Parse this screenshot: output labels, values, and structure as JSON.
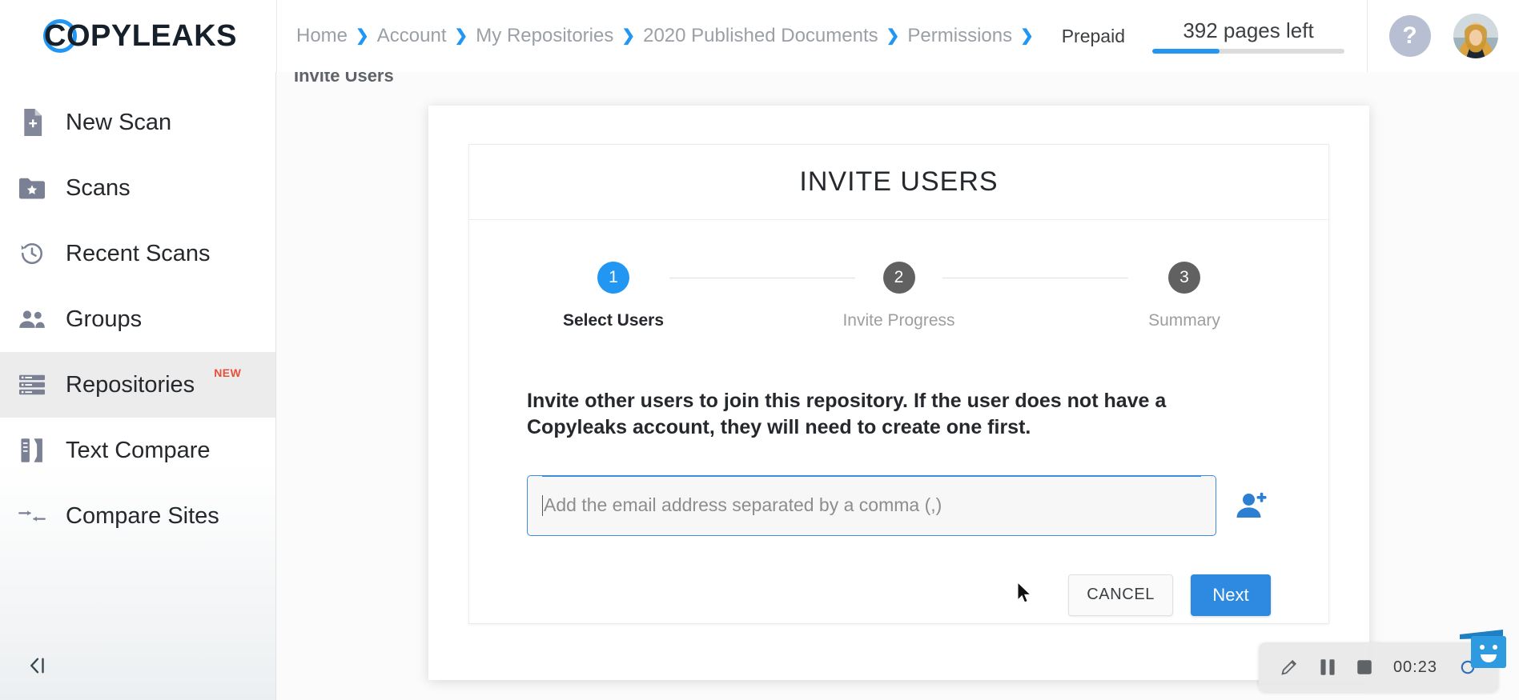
{
  "brand": {
    "name": "COPYLEAKS",
    "ring_color": "#2196f3",
    "accent_color": "#2196f3"
  },
  "header": {
    "breadcrumb": [
      "Home",
      "Account",
      "My Repositories",
      "2020 Published Documents",
      "Permissions"
    ],
    "breadcrumb_separator": "❯",
    "plan_label": "Prepaid",
    "quota_label": "392 pages left",
    "quota_percent": 35,
    "help_icon_glyph": "?",
    "help_icon_name": "question-mark-icon"
  },
  "sidebar": {
    "items": [
      {
        "label": "New Scan",
        "icon": "document-add-icon",
        "active": false,
        "badge": ""
      },
      {
        "label": "Scans",
        "icon": "folder-star-icon",
        "active": false,
        "badge": ""
      },
      {
        "label": "Recent Scans",
        "icon": "history-clock-icon",
        "active": false,
        "badge": ""
      },
      {
        "label": "Groups",
        "icon": "people-icon",
        "active": false,
        "badge": ""
      },
      {
        "label": "Repositories",
        "icon": "list-rows-icon",
        "active": true,
        "badge": "NEW"
      },
      {
        "label": "Text Compare",
        "icon": "compare-pages-icon",
        "active": false,
        "badge": ""
      },
      {
        "label": "Compare Sites",
        "icon": "compare-arrows-icon",
        "active": false,
        "badge": ""
      }
    ],
    "badge_color": "#e8503a",
    "collapse_icon": "collapse-sidebar-icon"
  },
  "page": {
    "subtitle": "Invite Users"
  },
  "modal": {
    "title": "INVITE USERS",
    "stepper": [
      {
        "number": "1",
        "label": "Select Users",
        "state": "active"
      },
      {
        "number": "2",
        "label": "Invite Progress",
        "state": "inactive"
      },
      {
        "number": "3",
        "label": "Summary",
        "state": "inactive"
      }
    ],
    "description": "Invite other users to join this repository. If the user does not have a Copyleaks account, they will need to create one first.",
    "email_input": {
      "value": "",
      "placeholder": "Add the email address separated by a comma (,)"
    },
    "add_user_icon": "add-person-icon",
    "cancel_label": "CANCEL",
    "next_label": "Next"
  },
  "recorder": {
    "pencil_icon": "pencil-icon",
    "pause_icon": "pause-icon",
    "stop_icon": "stop-icon",
    "timer": "00:23",
    "restart_icon": "restart-icon"
  }
}
